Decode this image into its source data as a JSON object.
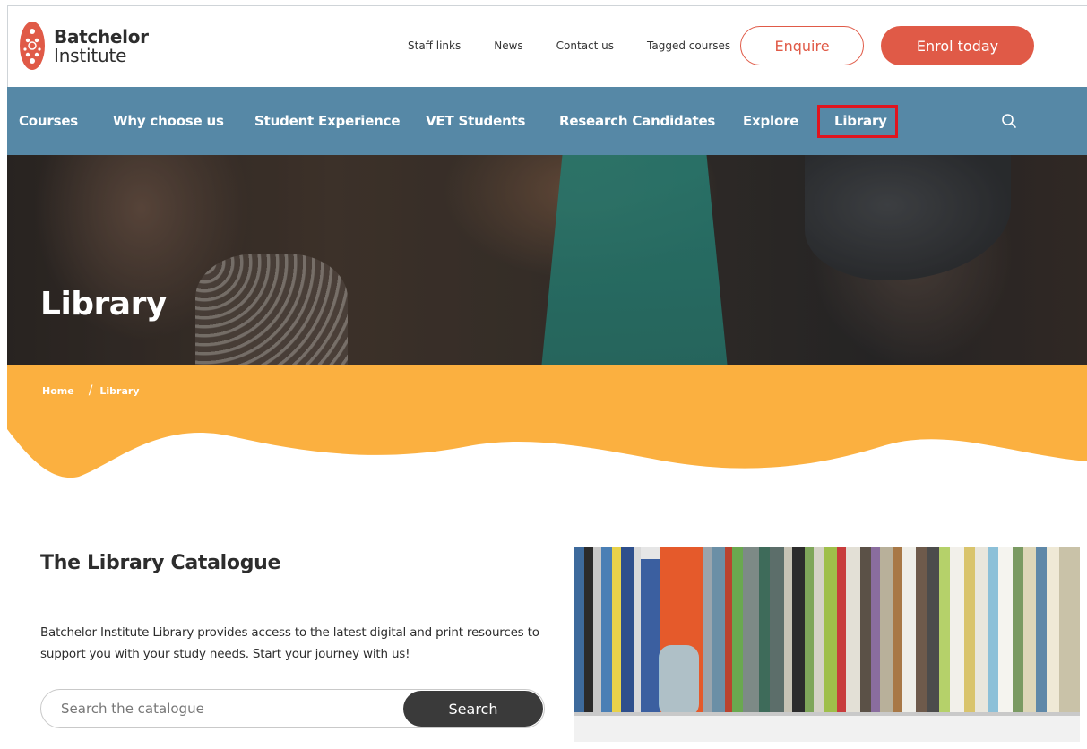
{
  "brand": {
    "name_line1": "Batchelor",
    "name_line2": "Institute",
    "accent": "#e05a47"
  },
  "utility_links": [
    "Staff links",
    "News",
    "Contact us",
    "Tagged courses"
  ],
  "header_buttons": {
    "enquire": "Enquire",
    "enrol": "Enrol today"
  },
  "nav": {
    "background": "#5688a6",
    "items": [
      "Courses",
      "Why choose us",
      "Student Experience",
      "VET Students",
      "Research Candidates",
      "Explore",
      "Library"
    ],
    "active": "Library"
  },
  "hero": {
    "title": "Library"
  },
  "breadcrumb": {
    "home": "Home",
    "separator": "/",
    "current": "Library",
    "band_color": "#fbb040"
  },
  "catalogue": {
    "title": "The Library Catalogue",
    "body": "Batchelor Institute Library provides access to the latest digital and print resources to support you with your study needs. Start your journey with us!",
    "search_placeholder": "Search the catalogue",
    "search_button": "Search"
  }
}
